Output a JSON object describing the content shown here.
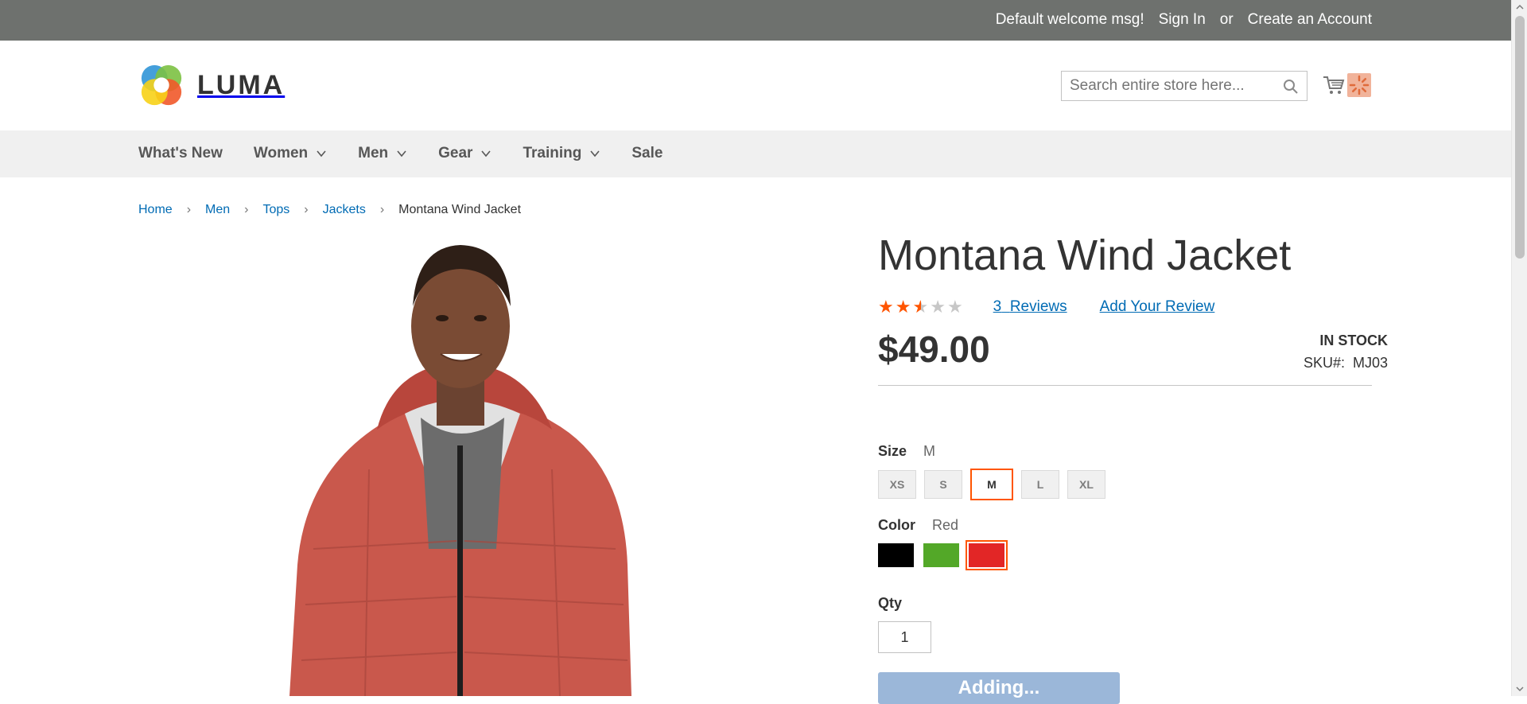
{
  "top_links": {
    "welcome": "Default welcome msg!",
    "sign_in": "Sign In",
    "or_text": "or",
    "create_account": "Create an Account"
  },
  "header": {
    "logo_text": "LUMA",
    "search_placeholder": "Search entire store here..."
  },
  "nav": {
    "items": [
      {
        "label": "What's New",
        "has_dropdown": false
      },
      {
        "label": "Women",
        "has_dropdown": true
      },
      {
        "label": "Men",
        "has_dropdown": true
      },
      {
        "label": "Gear",
        "has_dropdown": true
      },
      {
        "label": "Training",
        "has_dropdown": true
      },
      {
        "label": "Sale",
        "has_dropdown": false
      }
    ]
  },
  "breadcrumbs": [
    "Home",
    "Men",
    "Tops",
    "Jackets",
    "Montana Wind Jacket"
  ],
  "product": {
    "title": "Montana Wind Jacket",
    "rating_stars": 2.5,
    "reviews_count": "3",
    "reviews_label": "Reviews",
    "add_review": "Add Your Review",
    "price": "$49.00",
    "stock": "IN STOCK",
    "sku_label": "SKU#:",
    "sku": "MJ03"
  },
  "options": {
    "size_label": "Size",
    "size_selected": "M",
    "sizes": [
      "XS",
      "S",
      "M",
      "L",
      "XL"
    ],
    "color_label": "Color",
    "color_selected": "Red",
    "colors": [
      {
        "name": "Black",
        "hex": "#000000"
      },
      {
        "name": "Green",
        "hex": "#53a828"
      },
      {
        "name": "Red",
        "hex": "#e22626"
      }
    ]
  },
  "qty": {
    "label": "Qty",
    "value": "1"
  },
  "add_button_label": "Adding..."
}
